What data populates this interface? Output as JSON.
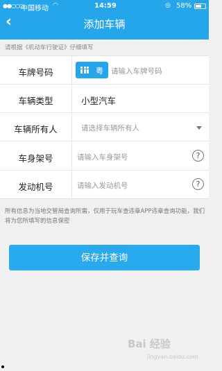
{
  "status_bar": {
    "signal": "●●○○○",
    "carrier": "中国移动",
    "time": "14:59",
    "battery": "58%"
  },
  "header": {
    "back_icon": "chevron-left-icon",
    "title": "添加车辆"
  },
  "hint": "请根据《机动车行驶证》仔细填写",
  "form": {
    "rows": [
      {
        "label": "车牌号码",
        "province": "粤",
        "placeholder": "请输入车牌号码"
      },
      {
        "label": "车辆类型",
        "value": "小型汽车"
      },
      {
        "label": "车辆所有人",
        "placeholder": "请选择车辆所有人"
      },
      {
        "label": "车身架号",
        "placeholder": "请输入车身架号"
      },
      {
        "label": "发动机号",
        "placeholder": "请输入发动机号"
      }
    ],
    "help_glyph": "?"
  },
  "notice": "所有信息为当地交管局查询所需，仅用于玩车查违章APP违章查询功能，我们将为您所填写的信息保密",
  "save_button": "保存并查询",
  "watermark": {
    "text": "Bai 经验",
    "sub": "jingyan.baidu.com"
  },
  "colors": {
    "accent": "#26a6ea",
    "background": "#f0f0f0"
  }
}
